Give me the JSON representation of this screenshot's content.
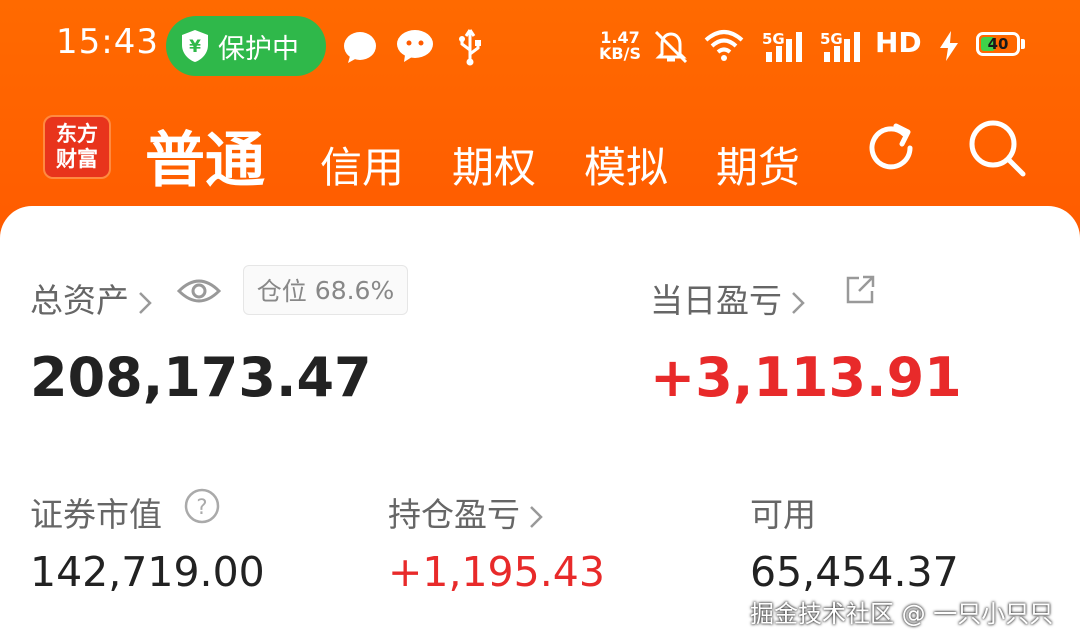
{
  "status_bar": {
    "time": "15:43",
    "protection_pill": "保护中",
    "net_speed_value": "1.47",
    "net_speed_unit": "KB/S",
    "sig1_label": "5G",
    "sig2_label": "5G",
    "hd_label": "HD",
    "battery": "40",
    "colors": {
      "pill": "#2fb84a",
      "battery_fill": "#3fd14a"
    }
  },
  "nav": {
    "logo_line1": "东方",
    "logo_line2": "财富",
    "tabs": [
      {
        "label": "普通",
        "active": true
      },
      {
        "label": "信用"
      },
      {
        "label": "期权"
      },
      {
        "label": "模拟"
      },
      {
        "label": "期货"
      }
    ],
    "icons": [
      "refresh-icon",
      "search-icon"
    ],
    "colors": {
      "header_bg": "#ff5a00",
      "logo_bg": "#e8341c"
    }
  },
  "account": {
    "total_assets_label": "总资产",
    "total_assets_value": "208,173.47",
    "position_label": "仓位",
    "position_value": "68.6%",
    "daily_pnl_label": "当日盈亏",
    "daily_pnl_value": "+3,113.91",
    "market_value_label": "证券市值",
    "market_value": "142,719.00",
    "holding_pnl_label": "持仓盈亏",
    "holding_pnl_value": "+1,195.43",
    "available_label": "可用",
    "available_value": "65,454.37",
    "colors": {
      "positive": "#e82a2a",
      "text": "#222222"
    }
  },
  "watermark": "掘金技术社区 @ 一只小只只"
}
